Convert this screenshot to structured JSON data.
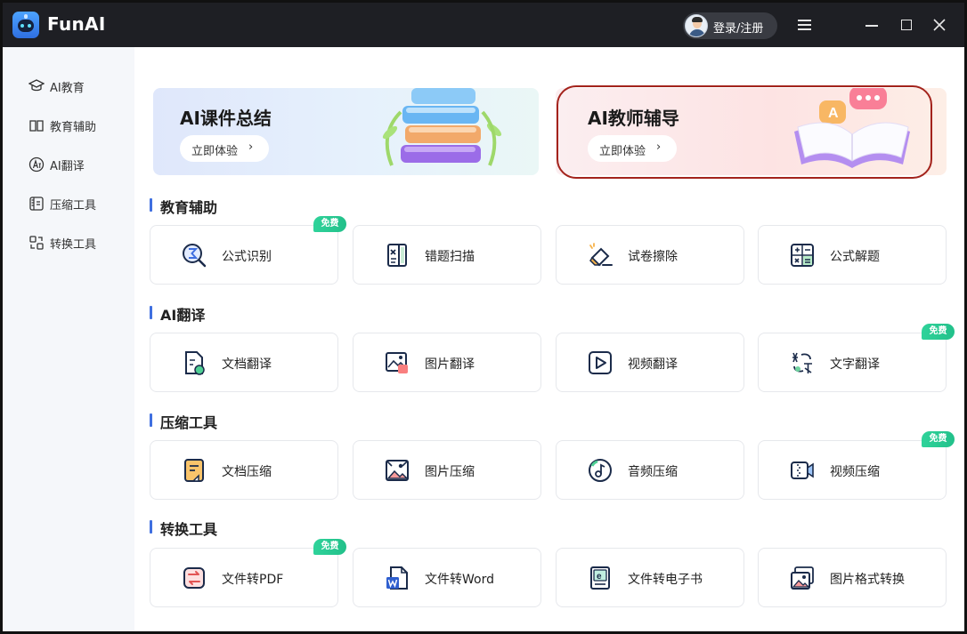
{
  "window": {
    "app_title": "FunAI",
    "login_label": "登录/注册"
  },
  "sidebar": {
    "items": [
      {
        "label": "AI教育",
        "icon": "graduation-cap-icon"
      },
      {
        "label": "教育辅助",
        "icon": "open-book-icon"
      },
      {
        "label": "AI翻译",
        "icon": "translate-icon"
      },
      {
        "label": "压缩工具",
        "icon": "archive-icon"
      },
      {
        "label": "转换工具",
        "icon": "convert-icon"
      }
    ]
  },
  "banners": [
    {
      "title": "AI课件总结",
      "button": "立即体验",
      "arrow": "›"
    },
    {
      "title": "AI教师辅导",
      "button": "立即体验",
      "arrow": "›"
    }
  ],
  "sections": [
    {
      "title": "教育辅助",
      "cards": [
        {
          "label": "公式识别",
          "icon": "sigma-search-icon",
          "badge": "免费"
        },
        {
          "label": "错题扫描",
          "icon": "notebook-x-icon",
          "badge": ""
        },
        {
          "label": "试卷擦除",
          "icon": "eraser-icon",
          "badge": ""
        },
        {
          "label": "公式解题",
          "icon": "calculator-icon",
          "badge": ""
        }
      ]
    },
    {
      "title": "AI翻译",
      "cards": [
        {
          "label": "文档翻译",
          "icon": "document-translate-icon",
          "badge": ""
        },
        {
          "label": "图片翻译",
          "icon": "image-translate-icon",
          "badge": ""
        },
        {
          "label": "视频翻译",
          "icon": "video-play-icon",
          "badge": ""
        },
        {
          "label": "文字翻译",
          "icon": "text-translate-icon",
          "badge": "免费"
        }
      ]
    },
    {
      "title": "压缩工具",
      "cards": [
        {
          "label": "文档压缩",
          "icon": "document-compress-icon",
          "badge": ""
        },
        {
          "label": "图片压缩",
          "icon": "image-compress-icon",
          "badge": ""
        },
        {
          "label": "音频压缩",
          "icon": "audio-note-icon",
          "badge": ""
        },
        {
          "label": "视频压缩",
          "icon": "video-camera-icon",
          "badge": "免费"
        }
      ]
    },
    {
      "title": "转换工具",
      "cards": [
        {
          "label": "文件转PDF",
          "icon": "file-convert-icon",
          "badge": "免费"
        },
        {
          "label": "文件转Word",
          "icon": "word-doc-icon",
          "badge": ""
        },
        {
          "label": "文件转电子书",
          "icon": "ebook-icon",
          "badge": ""
        },
        {
          "label": "图片格式转换",
          "icon": "image-format-icon",
          "badge": ""
        }
      ]
    }
  ],
  "colors": {
    "titlebar": "#1e1f24",
    "accent": "#3f6fe0",
    "badge": "#22c08a",
    "highlight": "#a3231c"
  }
}
